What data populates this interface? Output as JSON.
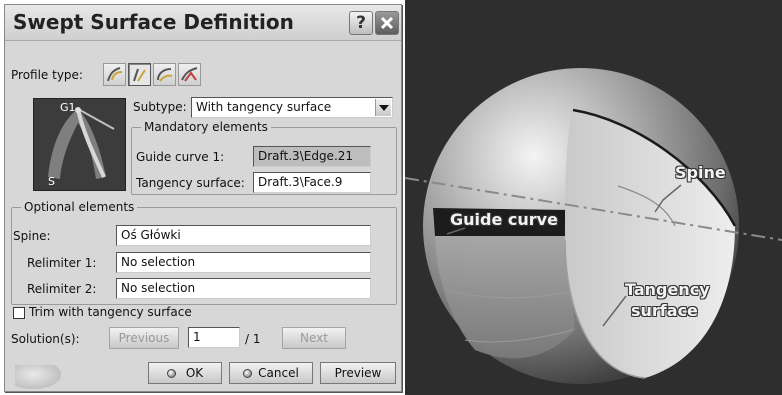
{
  "dialog": {
    "title": "Swept Surface Definition",
    "help_glyph": "?",
    "profile_type_label": "Profile type:",
    "profile_type_icons": [
      "explicit-profile-icon",
      "line-profile-icon",
      "circle-profile-icon",
      "conic-profile-icon"
    ],
    "subtype_label": "Subtype:",
    "subtype_value": "With tangency surface",
    "thumbnail": {
      "top_label": "G1",
      "bottom_label": "S"
    },
    "mandatory": {
      "title": "Mandatory elements",
      "guide_curve_label": "Guide curve 1:",
      "guide_curve_value": "Draft.3\\Edge.21",
      "tangency_label": "Tangency surface:",
      "tangency_value": "Draft.3\\Face.9"
    },
    "optional": {
      "title": "Optional elements",
      "spine_label": "Spine:",
      "spine_value": "Oś Główki",
      "relimiter1_label": "Relimiter 1:",
      "relimiter1_value": "No selection",
      "relimiter2_label": "Relimiter 2:",
      "relimiter2_value": "No selection"
    },
    "trim_label": "Trim with tangency surface",
    "trim_checked": false,
    "solutions": {
      "label": "Solution(s):",
      "previous": "Previous",
      "current": "1",
      "total": "/ 1",
      "next": "Next"
    },
    "buttons": {
      "ok": "OK",
      "cancel": "Cancel",
      "preview": "Preview"
    }
  },
  "viewport": {
    "labels": {
      "spine": "Spine",
      "guide_curve": "Guide curve",
      "tangency_line1": "Tangency",
      "tangency_line2": "surface"
    }
  }
}
